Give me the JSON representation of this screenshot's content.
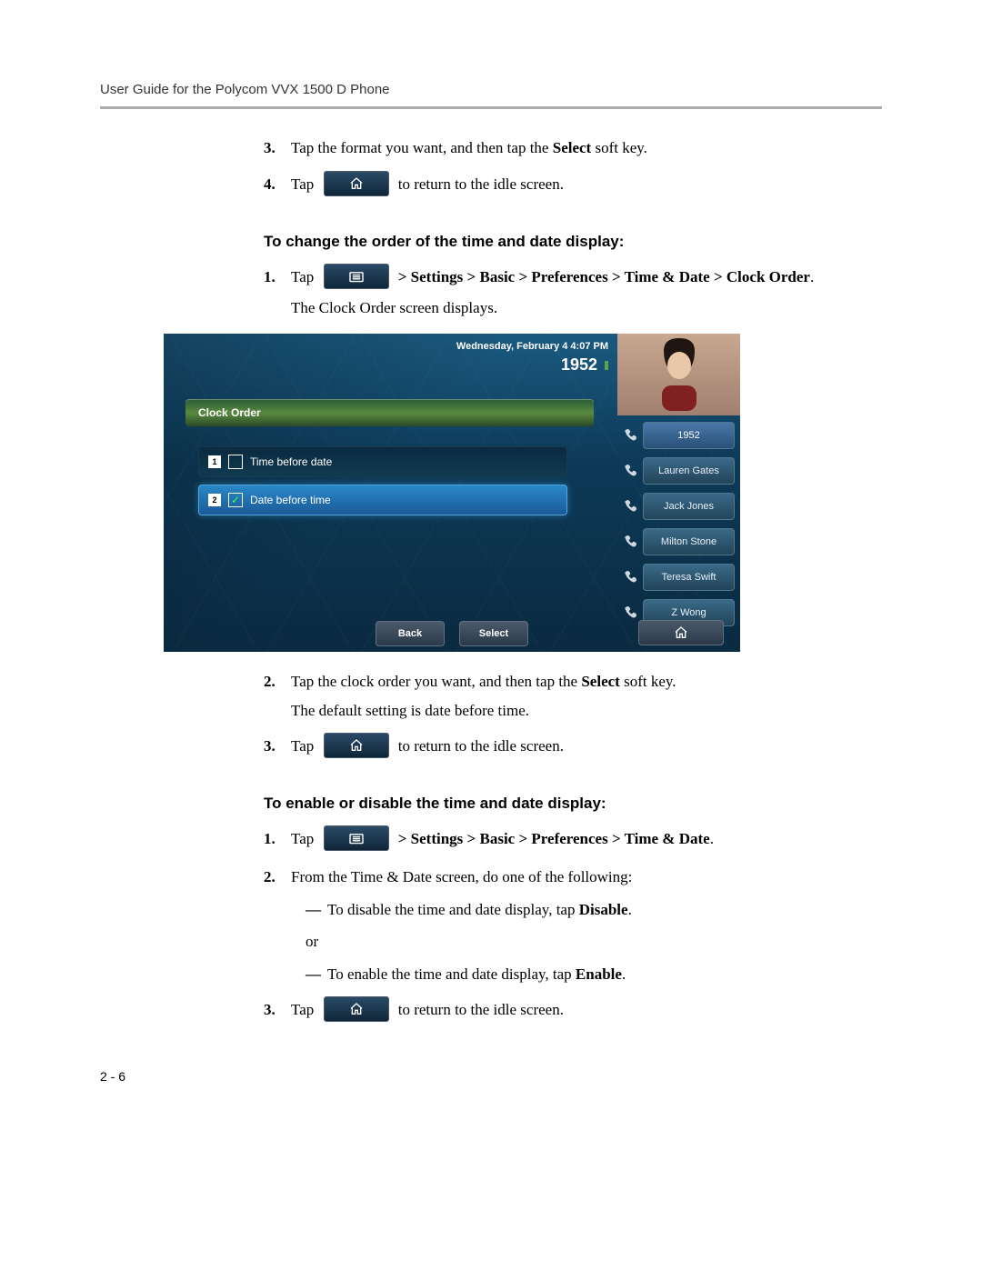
{
  "header": "User Guide for the Polycom VVX 1500 D Phone",
  "page_num": "2 - 6",
  "sec1": {
    "s3": {
      "num": "3.",
      "a": "Tap the format you want, and then tap the ",
      "b": "Select",
      "c": " soft key."
    },
    "s4": {
      "num": "4.",
      "a": "Tap ",
      "b": "to return to the idle screen."
    }
  },
  "sec2": {
    "heading": "To change the order of the time and date display:",
    "s1": {
      "num": "1.",
      "a": "Tap ",
      "nav": "> Settings > Basic > Preferences > Time & Date > Clock Order",
      "dot": ".",
      "sub": "The Clock Order screen displays."
    },
    "s2": {
      "num": "2.",
      "a": "Tap the clock order you want, and then tap the ",
      "b": "Select",
      "c": " soft key.",
      "sub": "The default setting is date before time."
    },
    "s3": {
      "num": "3.",
      "a": "Tap ",
      "b": "to return to the idle screen."
    }
  },
  "sec3": {
    "heading": "To enable or disable the time and date display:",
    "s1": {
      "num": "1.",
      "a": "Tap ",
      "nav": "> Settings > Basic > Preferences > Time & Date",
      "dot": "."
    },
    "s2": {
      "num": "2.",
      "text": "From the Time & Date screen, do one of the following:",
      "d1a": "To disable the time and date display, tap ",
      "d1b": "Disable",
      "d1c": ".",
      "or": "or",
      "d2a": "To enable the time and date display, tap ",
      "d2b": "Enable",
      "d2c": "."
    },
    "s3": {
      "num": "3.",
      "a": "Tap ",
      "b": "to return to the idle screen."
    }
  },
  "screenshot": {
    "datetime": "Wednesday, February 4  4:07 PM",
    "ext": "1952",
    "title": "Clock Order",
    "opt1": {
      "n": "1",
      "label": "Time before date"
    },
    "opt2": {
      "n": "2",
      "label": "Date before time"
    },
    "contacts": [
      "1952",
      "Lauren Gates",
      "Jack Jones",
      "Milton Stone",
      "Teresa Swift",
      "Z Wong"
    ],
    "soft_back": "Back",
    "soft_select": "Select"
  }
}
